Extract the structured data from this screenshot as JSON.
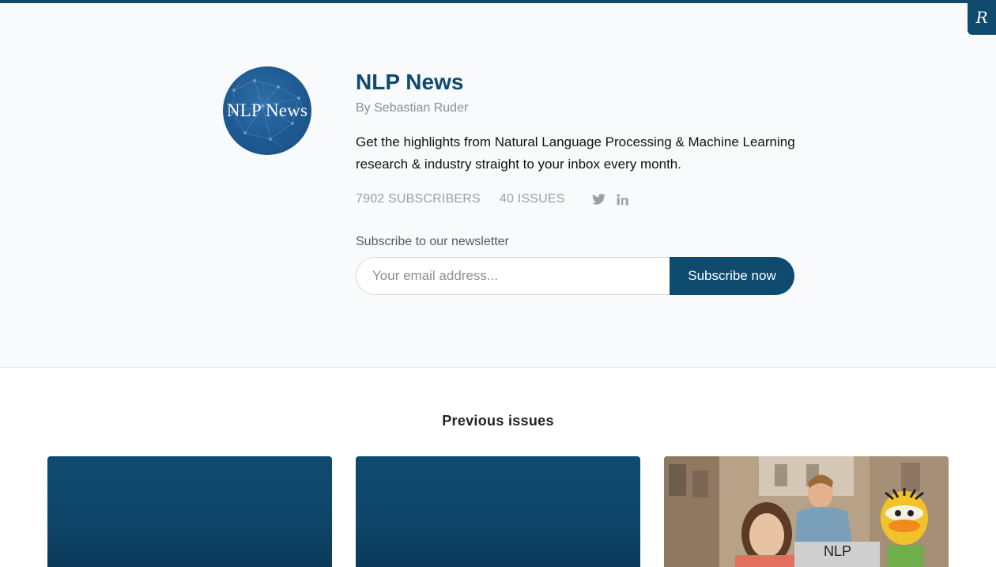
{
  "brand_badge": {
    "glyph": "R"
  },
  "newsletter": {
    "logo_text": "NLP News",
    "title": "NLP News",
    "byline": "By Sebastian Ruder",
    "description": "Get the highlights from Natural Language Processing & Machine Learning research & industry straight to your inbox every month.",
    "subscribers": "7902 SUBSCRIBERS",
    "issues": "40 ISSUES",
    "social": [
      {
        "icon": "twitter-icon"
      },
      {
        "icon": "linkedin-icon"
      }
    ]
  },
  "subscribe": {
    "label": "Subscribe to our newsletter",
    "placeholder": "Your email address...",
    "button_label": "Subscribe now"
  },
  "previous": {
    "heading": "Previous issues",
    "cards": [
      {
        "style": "blue"
      },
      {
        "style": "blue"
      },
      {
        "style": "photo",
        "sign_text": "NLP"
      }
    ]
  },
  "colors": {
    "accent": "#0f4a6f",
    "hero_bg": "#f8fafc",
    "muted_text": "#9aa0a6"
  }
}
